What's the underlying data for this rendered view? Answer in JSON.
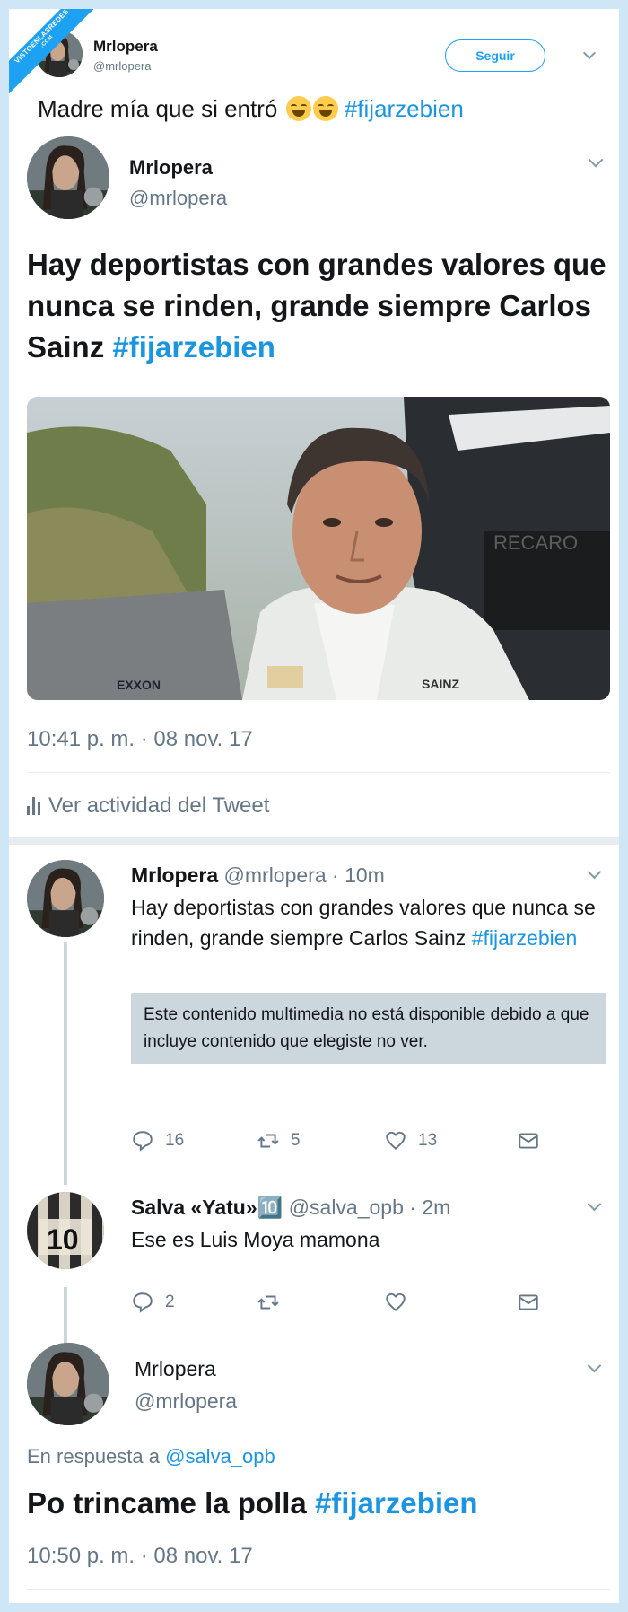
{
  "watermark": {
    "line1": "VISTOENLASREDES",
    "line2": ".COM"
  },
  "outer_tweet": {
    "name": "Mrlopera",
    "handle": "@mrlopera",
    "follow_label": "Seguir",
    "text": "Madre mía que si entró",
    "hashtag": "#fijarzebien"
  },
  "quoted_tweet": {
    "name": "Mrlopera",
    "handle": "@mrlopera",
    "text": "Hay deportistas con grandes valores que nunca se rinden, grande siempre Carlos Sainz",
    "hashtag": "#fijarzebien",
    "photo_labels": {
      "sponsor": "RECARO",
      "badge": "SAINZ",
      "brand": "EXXON"
    },
    "timestamp": "10:41 p. m. · 08 nov. 17",
    "activity_label": "Ver actividad del Tweet"
  },
  "thread": [
    {
      "name": "Mrlopera",
      "handle": "@mrlopera · 10m",
      "text": "Hay deportistas con grandes valores que nunca se rinden, grande siempre Carlos Sainz",
      "hashtag": "#fijarzebien",
      "media_notice": "Este contenido multimedia no está disponible debido a que incluye contenido que elegiste no ver.",
      "replies": "16",
      "retweets": "5",
      "likes": "13"
    },
    {
      "name": "Salva «Yatu»🔟",
      "handle": "@salva_opb · 2m",
      "text": "Ese es Luis Moya mamona",
      "replies": "2",
      "retweets": "",
      "likes": ""
    }
  ],
  "final_tweet": {
    "name": "Mrlopera",
    "handle": "@mrlopera",
    "in_reply_prefix": "En respuesta a",
    "in_reply_to": "@salva_opb",
    "text": "Po trincame la polla",
    "hashtag": "#fijarzebien",
    "timestamp": "10:50 p. m. · 08 nov. 17"
  },
  "colors": {
    "link": "#1b95e0",
    "muted": "#657786",
    "background": "#cfe6f7",
    "notice": "#ccd6dd"
  }
}
